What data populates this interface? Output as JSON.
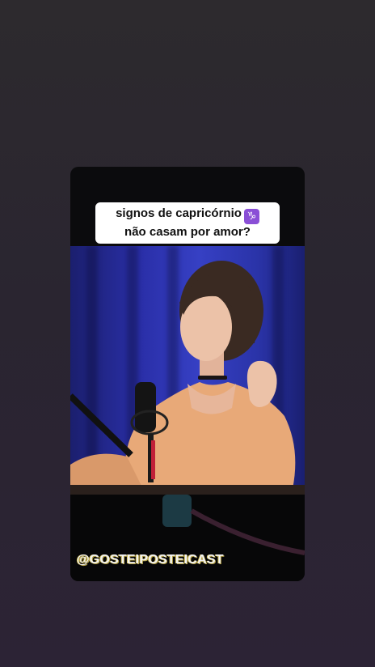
{
  "story": {
    "caption_line1": "signos de capricórnio",
    "caption_icon": "capricorn-icon",
    "caption_glyph": "♑",
    "caption_line2": "não casam por amor?",
    "handle": "@GOSTEIPOSTEICAST"
  },
  "colors": {
    "background": "#2b2630",
    "backdrop_blue": "#3640c4",
    "caption_bg": "#ffffff",
    "zodiac_badge": "#8a4fd6"
  }
}
